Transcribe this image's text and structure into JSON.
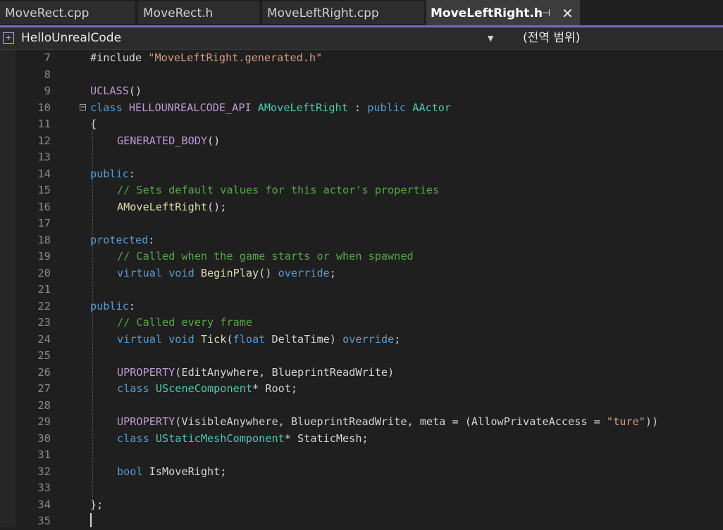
{
  "tabs": [
    {
      "label": "MoveRect.cpp"
    },
    {
      "label": "MoveRect.h"
    },
    {
      "label": "MoveLeftRight.cpp"
    },
    {
      "label": "MoveLeftRight.h",
      "pin_glyph": "⊣",
      "close_glyph": "✕"
    }
  ],
  "nav": {
    "project": "HelloUnrealCode",
    "dropdown_glyph": "▼",
    "scope": "(전역 범위)"
  },
  "editor": {
    "lines": [
      {
        "n": "7",
        "tokens": [
          {
            "t": "#include ",
            "c": "pl"
          },
          {
            "t": "\"MoveLeftRight.generated.h\"",
            "c": "str"
          }
        ]
      },
      {
        "n": "8",
        "tokens": []
      },
      {
        "n": "9",
        "tokens": [
          {
            "t": "UCLASS",
            "c": "mac"
          },
          {
            "t": "()",
            "c": "pl"
          }
        ]
      },
      {
        "n": "10",
        "tokens": [
          {
            "t": "class ",
            "c": "kw"
          },
          {
            "t": "HELLOUNREALCODE_API ",
            "c": "mac"
          },
          {
            "t": "AMoveLeftRight",
            "c": "ty"
          },
          {
            "t": " : ",
            "c": "pl"
          },
          {
            "t": "public ",
            "c": "kw"
          },
          {
            "t": "AActor",
            "c": "ty"
          }
        ],
        "fold": "−"
      },
      {
        "n": "11",
        "tokens": [
          {
            "t": "{",
            "c": "pl"
          }
        ]
      },
      {
        "n": "12",
        "indent": 1,
        "tokens": [
          {
            "t": "GENERATED_BODY",
            "c": "mac"
          },
          {
            "t": "()",
            "c": "pl"
          }
        ]
      },
      {
        "n": "13",
        "tokens": []
      },
      {
        "n": "14",
        "tokens": [
          {
            "t": "public",
            "c": "kw"
          },
          {
            "t": ":",
            "c": "pl"
          }
        ]
      },
      {
        "n": "15",
        "indent": 1,
        "tokens": [
          {
            "t": "// Sets default values for this actor's properties",
            "c": "cm"
          }
        ]
      },
      {
        "n": "16",
        "indent": 1,
        "tokens": [
          {
            "t": "AMoveLeftRight",
            "c": "fn"
          },
          {
            "t": "();",
            "c": "pl"
          }
        ]
      },
      {
        "n": "17",
        "tokens": []
      },
      {
        "n": "18",
        "tokens": [
          {
            "t": "protected",
            "c": "kw"
          },
          {
            "t": ":",
            "c": "pl"
          }
        ]
      },
      {
        "n": "19",
        "indent": 1,
        "tokens": [
          {
            "t": "// Called when the game starts or when spawned",
            "c": "cm"
          }
        ]
      },
      {
        "n": "20",
        "indent": 1,
        "tokens": [
          {
            "t": "virtual ",
            "c": "kw"
          },
          {
            "t": "void ",
            "c": "kw"
          },
          {
            "t": "BeginPlay",
            "c": "fn"
          },
          {
            "t": "() ",
            "c": "pl"
          },
          {
            "t": "override",
            "c": "kw"
          },
          {
            "t": ";",
            "c": "pl"
          }
        ]
      },
      {
        "n": "21",
        "tokens": []
      },
      {
        "n": "22",
        "tokens": [
          {
            "t": "public",
            "c": "kw"
          },
          {
            "t": ":",
            "c": "pl"
          }
        ]
      },
      {
        "n": "23",
        "indent": 1,
        "tokens": [
          {
            "t": "// Called every frame",
            "c": "cm"
          }
        ]
      },
      {
        "n": "24",
        "indent": 1,
        "tokens": [
          {
            "t": "virtual ",
            "c": "kw"
          },
          {
            "t": "void ",
            "c": "kw"
          },
          {
            "t": "Tick",
            "c": "fn"
          },
          {
            "t": "(",
            "c": "pl"
          },
          {
            "t": "float ",
            "c": "kw"
          },
          {
            "t": "DeltaTime",
            "c": "pl"
          },
          {
            "t": ") ",
            "c": "pl"
          },
          {
            "t": "override",
            "c": "kw"
          },
          {
            "t": ";",
            "c": "pl"
          }
        ]
      },
      {
        "n": "25",
        "tokens": []
      },
      {
        "n": "26",
        "indent": 1,
        "tokens": [
          {
            "t": "UPROPERTY",
            "c": "mac"
          },
          {
            "t": "(EditAnywhere, BlueprintReadWrite)",
            "c": "pl"
          }
        ]
      },
      {
        "n": "27",
        "indent": 1,
        "tokens": [
          {
            "t": "class ",
            "c": "kw"
          },
          {
            "t": "USceneComponent",
            "c": "ty"
          },
          {
            "t": "* Root;",
            "c": "pl"
          }
        ]
      },
      {
        "n": "28",
        "tokens": []
      },
      {
        "n": "29",
        "indent": 1,
        "tokens": [
          {
            "t": "UPROPERTY",
            "c": "mac"
          },
          {
            "t": "(VisibleAnywhere, BlueprintReadWrite, meta = (AllowPrivateAccess = ",
            "c": "pl"
          },
          {
            "t": "\"ture\"",
            "c": "str"
          },
          {
            "t": "))",
            "c": "pl"
          }
        ]
      },
      {
        "n": "30",
        "indent": 1,
        "tokens": [
          {
            "t": "class ",
            "c": "kw"
          },
          {
            "t": "UStaticMeshComponent",
            "c": "ty"
          },
          {
            "t": "* StaticMesh;",
            "c": "pl"
          }
        ]
      },
      {
        "n": "31",
        "tokens": []
      },
      {
        "n": "32",
        "indent": 1,
        "tokens": [
          {
            "t": "bool ",
            "c": "kw"
          },
          {
            "t": "IsMoveRight;",
            "c": "pl"
          }
        ]
      },
      {
        "n": "33",
        "tokens": []
      },
      {
        "n": "34",
        "tokens": [
          {
            "t": "};",
            "c": "pl"
          }
        ]
      },
      {
        "n": "35",
        "tokens": []
      }
    ]
  }
}
